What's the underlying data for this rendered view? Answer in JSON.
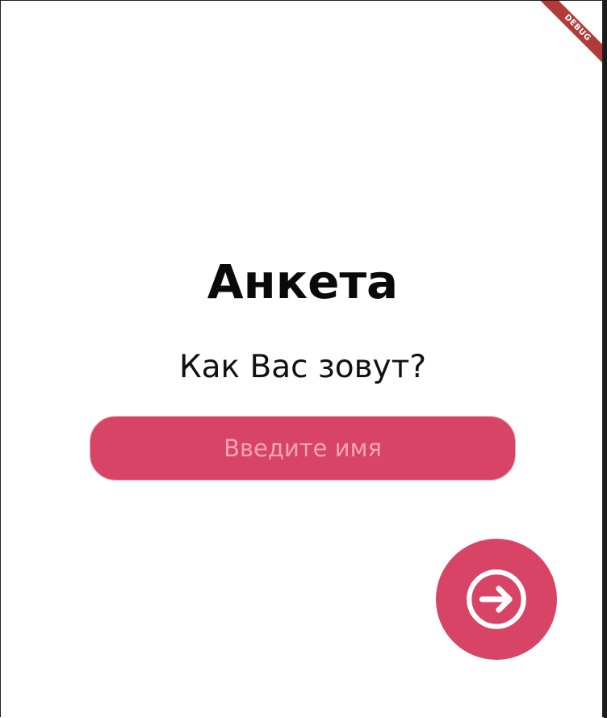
{
  "debug_banner": {
    "label": "DEBUG"
  },
  "form": {
    "title": "Анкета",
    "question": "Как Вас зовут?",
    "name_input": {
      "value": "",
      "placeholder": "Введите имя"
    }
  },
  "next_button": {
    "icon": "arrow-right-circle-icon"
  },
  "colors": {
    "accent": "#d84466",
    "placeholder": "#f3a4b7",
    "text": "#111111",
    "debug": "#b13b3b"
  }
}
